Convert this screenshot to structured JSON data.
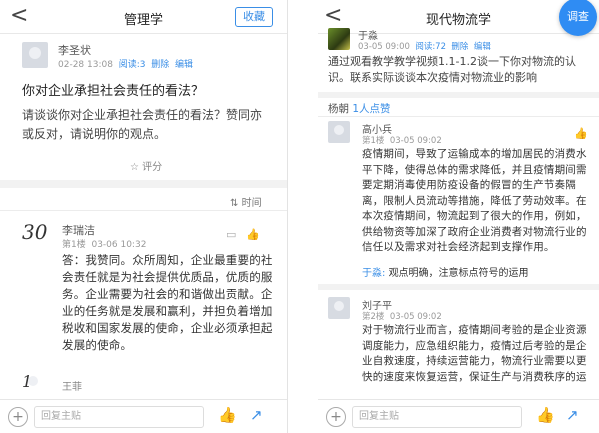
{
  "left": {
    "header": {
      "back": "<",
      "title": "管理学",
      "fav_label": "收藏"
    },
    "post": {
      "author": "李圣状",
      "date": "02-28 13:08",
      "reads": "阅读:3",
      "reads_label": "阅读:3",
      "delete": "删除",
      "edit": "编辑",
      "title": "你对企业承担社会责任的看法？",
      "body": "请谈谈你对企业承担社会责任的看法？赞同亦或反对，请说明你的观点。"
    },
    "rate_label": "评分",
    "time_label": "时间",
    "reply": {
      "score": "30",
      "author": "李瑞洁",
      "floor": "第1楼",
      "date": "03-06 10:32",
      "text": "答：我赞同。众所周知，企业最重要的社会责任就是为社会提供优质品，优质的服务。企业需要为社会的和谐做出贡献。企业的任务就是发展和赢利，并担负着增加税收和国家发展的使命，企业必须承担起发展的使命。"
    },
    "next_author": "王菲",
    "bottom": {
      "placeholder": "回复主贴"
    }
  },
  "right": {
    "header": {
      "back": "<",
      "title": "现代物流学",
      "fab_label": "调查"
    },
    "post": {
      "author": "于淼",
      "date": "03-05 09:00",
      "reads": "阅读:72",
      "reads_label": "阅读:72",
      "delete": "删除",
      "edit": "编辑",
      "body": "通过观看教学教学视频1.1-1.2谈一下你对物流的认识。联系实际谈谈本次疫情对物流业的影响"
    },
    "likes_author": "杨朝",
    "likes_label": "1人点赞",
    "reply1": {
      "author": "高小兵",
      "floor": "第1楼",
      "date": "03-05 09:02",
      "text": "疫情期间，导致了运输成本的增加居民的消费水平下降，使得总体的需求降低，并且疫情期间需要定期消毒使用防疫设备的假冒的生产节奏隔离，限制人员流动等措施，降低了劳动效率。在本次疫情期间，物流起到了很大的作用，例如，供给物资等加深了政府企业消费者对物流行业的信任以及需求对社会经济起到支撑作用。",
      "comment_author": "于淼:",
      "comment_text": "观点明确，注意标点符号的运用"
    },
    "reply2": {
      "author": "刘子平",
      "floor": "第2楼",
      "date": "03-05 09:02",
      "text": "对于物流行业而言，疫情期间考验的是企业资源调度能力，应急组织能力，疫情过后考验的是企业自救速度，持续运营能力，物流行业需要以更快的速度来恢复运营，保证生产与消费秩序的运"
    },
    "bottom": {
      "placeholder": "回复主贴"
    }
  },
  "icons": {
    "back": "chevron-left-icon",
    "rate": "star-icon",
    "time": "sort-icon",
    "like": "thumb-up-icon",
    "share": "share-icon",
    "add": "plus-icon"
  },
  "colors": {
    "accent": "#3a8ee6",
    "fab": "#2f8cf3"
  }
}
